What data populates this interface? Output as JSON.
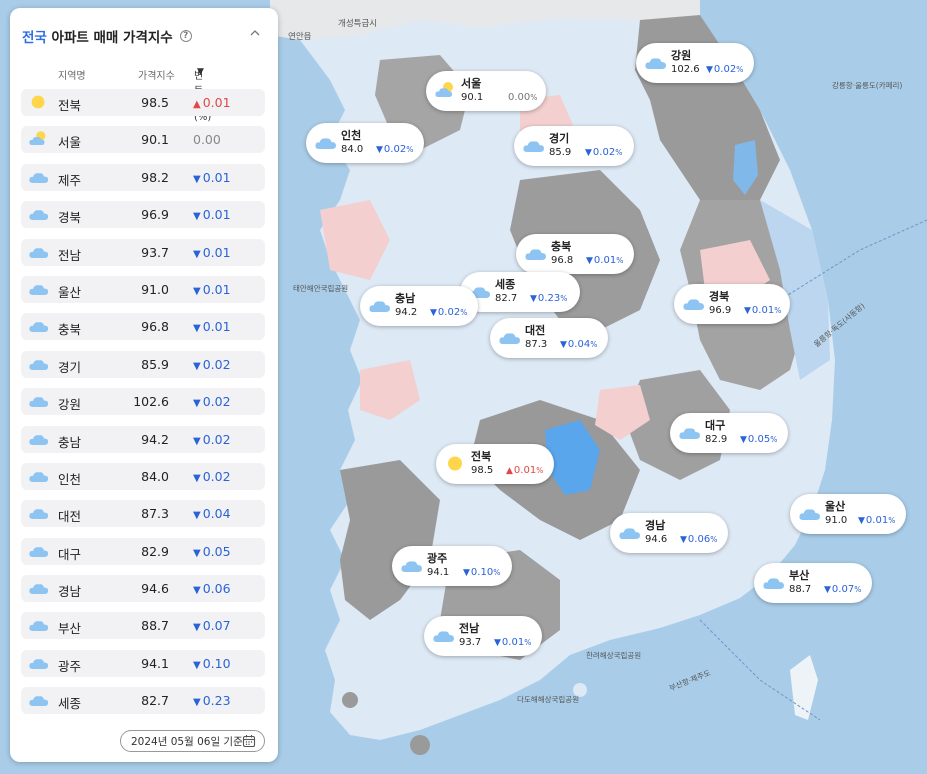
{
  "panel": {
    "title_accent": "전국",
    "title_rest": "아파트 매매 가격지수",
    "help_icon": "question-circle-icon",
    "collapse_icon": "chevron-up-icon",
    "columns": {
      "region": "지역명",
      "index": "가격지수",
      "change": "변동률(%)"
    },
    "sort_icon": "triangle-down-icon",
    "date": "2024년 05월 06일 기준",
    "calendar_icon": "calendar-icon"
  },
  "rows": [
    {
      "name": "전북",
      "icon": "sun-icon",
      "value": "98.5",
      "dir": "up",
      "change": "0.01"
    },
    {
      "name": "서울",
      "icon": "sun-cloud-icon",
      "value": "90.1",
      "dir": "flat",
      "change": "0.00"
    },
    {
      "name": "제주",
      "icon": "cloud-icon",
      "value": "98.2",
      "dir": "down",
      "change": "0.01"
    },
    {
      "name": "경북",
      "icon": "cloud-icon",
      "value": "96.9",
      "dir": "down",
      "change": "0.01"
    },
    {
      "name": "전남",
      "icon": "cloud-icon",
      "value": "93.7",
      "dir": "down",
      "change": "0.01"
    },
    {
      "name": "울산",
      "icon": "cloud-icon",
      "value": "91.0",
      "dir": "down",
      "change": "0.01"
    },
    {
      "name": "충북",
      "icon": "cloud-icon",
      "value": "96.8",
      "dir": "down",
      "change": "0.01"
    },
    {
      "name": "경기",
      "icon": "cloud-icon",
      "value": "85.9",
      "dir": "down",
      "change": "0.02"
    },
    {
      "name": "강원",
      "icon": "cloud-icon",
      "value": "102.6",
      "dir": "down",
      "change": "0.02"
    },
    {
      "name": "충남",
      "icon": "cloud-icon",
      "value": "94.2",
      "dir": "down",
      "change": "0.02"
    },
    {
      "name": "인천",
      "icon": "cloud-icon",
      "value": "84.0",
      "dir": "down",
      "change": "0.02"
    },
    {
      "name": "대전",
      "icon": "cloud-icon",
      "value": "87.3",
      "dir": "down",
      "change": "0.04"
    },
    {
      "name": "대구",
      "icon": "cloud-icon",
      "value": "82.9",
      "dir": "down",
      "change": "0.05"
    },
    {
      "name": "경남",
      "icon": "cloud-icon",
      "value": "94.6",
      "dir": "down",
      "change": "0.06"
    },
    {
      "name": "부산",
      "icon": "cloud-icon",
      "value": "88.7",
      "dir": "down",
      "change": "0.07"
    },
    {
      "name": "광주",
      "icon": "cloud-icon",
      "value": "94.1",
      "dir": "down",
      "change": "0.10"
    },
    {
      "name": "세종",
      "icon": "cloud-icon",
      "value": "82.7",
      "dir": "down",
      "change": "0.23"
    }
  ],
  "map": {
    "bubbles": [
      {
        "name": "강원",
        "icon": "cloud-icon",
        "value": "102.6",
        "dir": "down",
        "change": "0.02"
      },
      {
        "name": "서울",
        "icon": "sun-cloud-icon",
        "value": "90.1",
        "dir": "flat",
        "change": "0.00"
      },
      {
        "name": "인천",
        "icon": "cloud-icon",
        "value": "84.0",
        "dir": "down",
        "change": "0.02"
      },
      {
        "name": "경기",
        "icon": "cloud-icon",
        "value": "85.9",
        "dir": "down",
        "change": "0.02"
      },
      {
        "name": "충북",
        "icon": "cloud-icon",
        "value": "96.8",
        "dir": "down",
        "change": "0.01"
      },
      {
        "name": "세종",
        "icon": "cloud-icon",
        "value": "82.7",
        "dir": "down",
        "change": "0.23"
      },
      {
        "name": "충남",
        "icon": "cloud-icon",
        "value": "94.2",
        "dir": "down",
        "change": "0.02"
      },
      {
        "name": "경북",
        "icon": "cloud-icon",
        "value": "96.9",
        "dir": "down",
        "change": "0.01"
      },
      {
        "name": "대전",
        "icon": "cloud-icon",
        "value": "87.3",
        "dir": "down",
        "change": "0.04"
      },
      {
        "name": "대구",
        "icon": "cloud-icon",
        "value": "82.9",
        "dir": "down",
        "change": "0.05"
      },
      {
        "name": "전북",
        "icon": "sun-icon",
        "value": "98.5",
        "dir": "up",
        "change": "0.01"
      },
      {
        "name": "울산",
        "icon": "cloud-icon",
        "value": "91.0",
        "dir": "down",
        "change": "0.01"
      },
      {
        "name": "경남",
        "icon": "cloud-icon",
        "value": "94.6",
        "dir": "down",
        "change": "0.06"
      },
      {
        "name": "광주",
        "icon": "cloud-icon",
        "value": "94.1",
        "dir": "down",
        "change": "0.10"
      },
      {
        "name": "부산",
        "icon": "cloud-icon",
        "value": "88.7",
        "dir": "down",
        "change": "0.07"
      },
      {
        "name": "전남",
        "icon": "cloud-icon",
        "value": "93.7",
        "dir": "down",
        "change": "0.01"
      }
    ],
    "labels": {
      "gaesong": "개성특급시",
      "yeonan": "연안읍",
      "ganghung": "강릉항·울릉도(카페리)",
      "dokdo": "울릉항·독도(사동항)",
      "busan_ferry": "부산항·제주도",
      "dado": "다도해해상국립공원",
      "hallyeo": "한려해상국립공원",
      "taean": "태안해안국립공원"
    },
    "colors": {
      "sea": "#a9cde9",
      "land_gray": "#9a9a9a",
      "land_light": "#dde9f5",
      "land_blue": "#bcd6ef",
      "land_pink": "#f3cfcf",
      "highlight_blue": "#5aa6ec",
      "up": "#e04848",
      "down": "#2a63d8"
    }
  }
}
